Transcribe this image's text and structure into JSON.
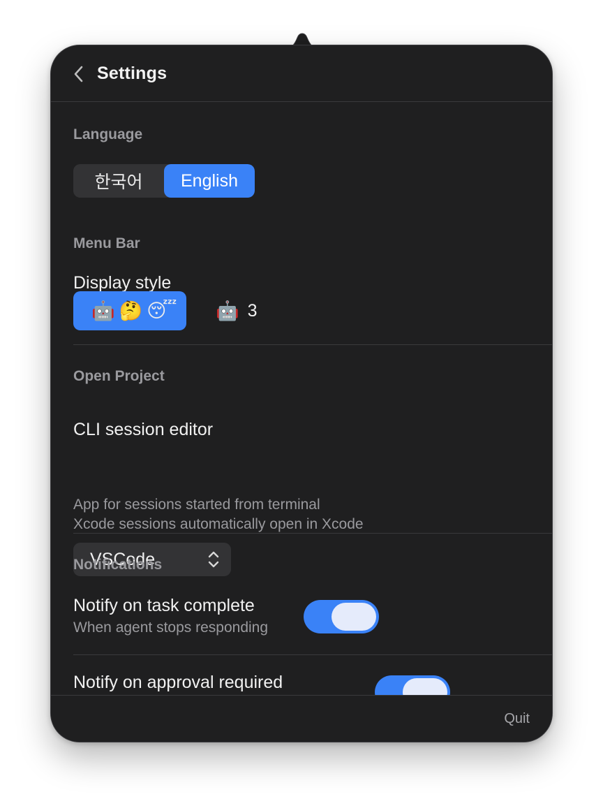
{
  "header": {
    "title": "Settings",
    "back_icon": "chevron-left-icon"
  },
  "language": {
    "section_title": "Language",
    "options": [
      "한국어",
      "English"
    ],
    "selected": "English"
  },
  "menu_bar": {
    "section_title": "Menu Bar",
    "display_style_label": "Display style",
    "style_options": [
      {
        "emojis": [
          "🤖",
          "🤔",
          "😴"
        ],
        "selected": true
      },
      {
        "emojis": [
          "🤖"
        ],
        "count": "3",
        "selected": false
      }
    ]
  },
  "open_project": {
    "section_title": "Open Project",
    "editor_label": "CLI session editor",
    "editor_desc_line1": "App for sessions started from terminal",
    "editor_desc_line2": "Xcode sessions automatically open in Xcode",
    "editor_value": "VSCode"
  },
  "notifications": {
    "section_title": "Notifications",
    "task_complete": {
      "label": "Notify on task complete",
      "description": "When agent stops responding",
      "enabled": true
    },
    "approval_required": {
      "label": "Notify on approval required",
      "enabled": true
    }
  },
  "footer": {
    "quit_label": "Quit"
  },
  "colors": {
    "panel_bg": "#1f1f20",
    "accent": "#3a82f7",
    "control_bg": "#333335"
  }
}
